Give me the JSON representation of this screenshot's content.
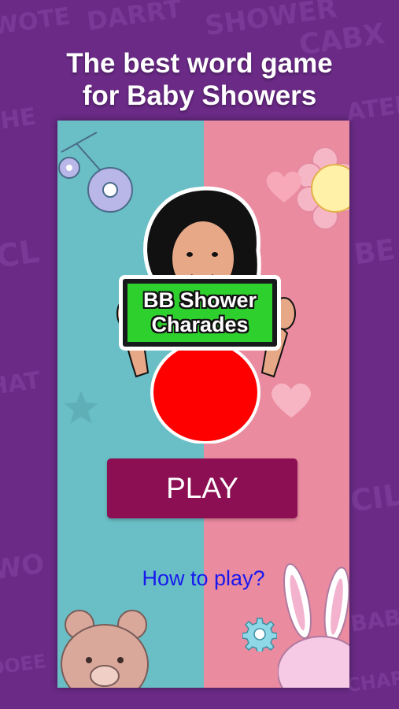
{
  "headline": {
    "line1": "The best word game",
    "line2": "for Baby Showers"
  },
  "logo": {
    "line1": "BB Shower",
    "line2": "Charades"
  },
  "play_button": "PLAY",
  "how_to_play": "How to play?",
  "settings_icon": "gear-icon",
  "colors": {
    "background": "#6a2a86",
    "left_panel": "#69bfc5",
    "right_panel": "#ea8ba0",
    "play_button": "#8b0f52",
    "sign": "#2ed02e",
    "belly": "#ff0000",
    "link": "#1818ee",
    "gear": "#8fd8e8"
  }
}
